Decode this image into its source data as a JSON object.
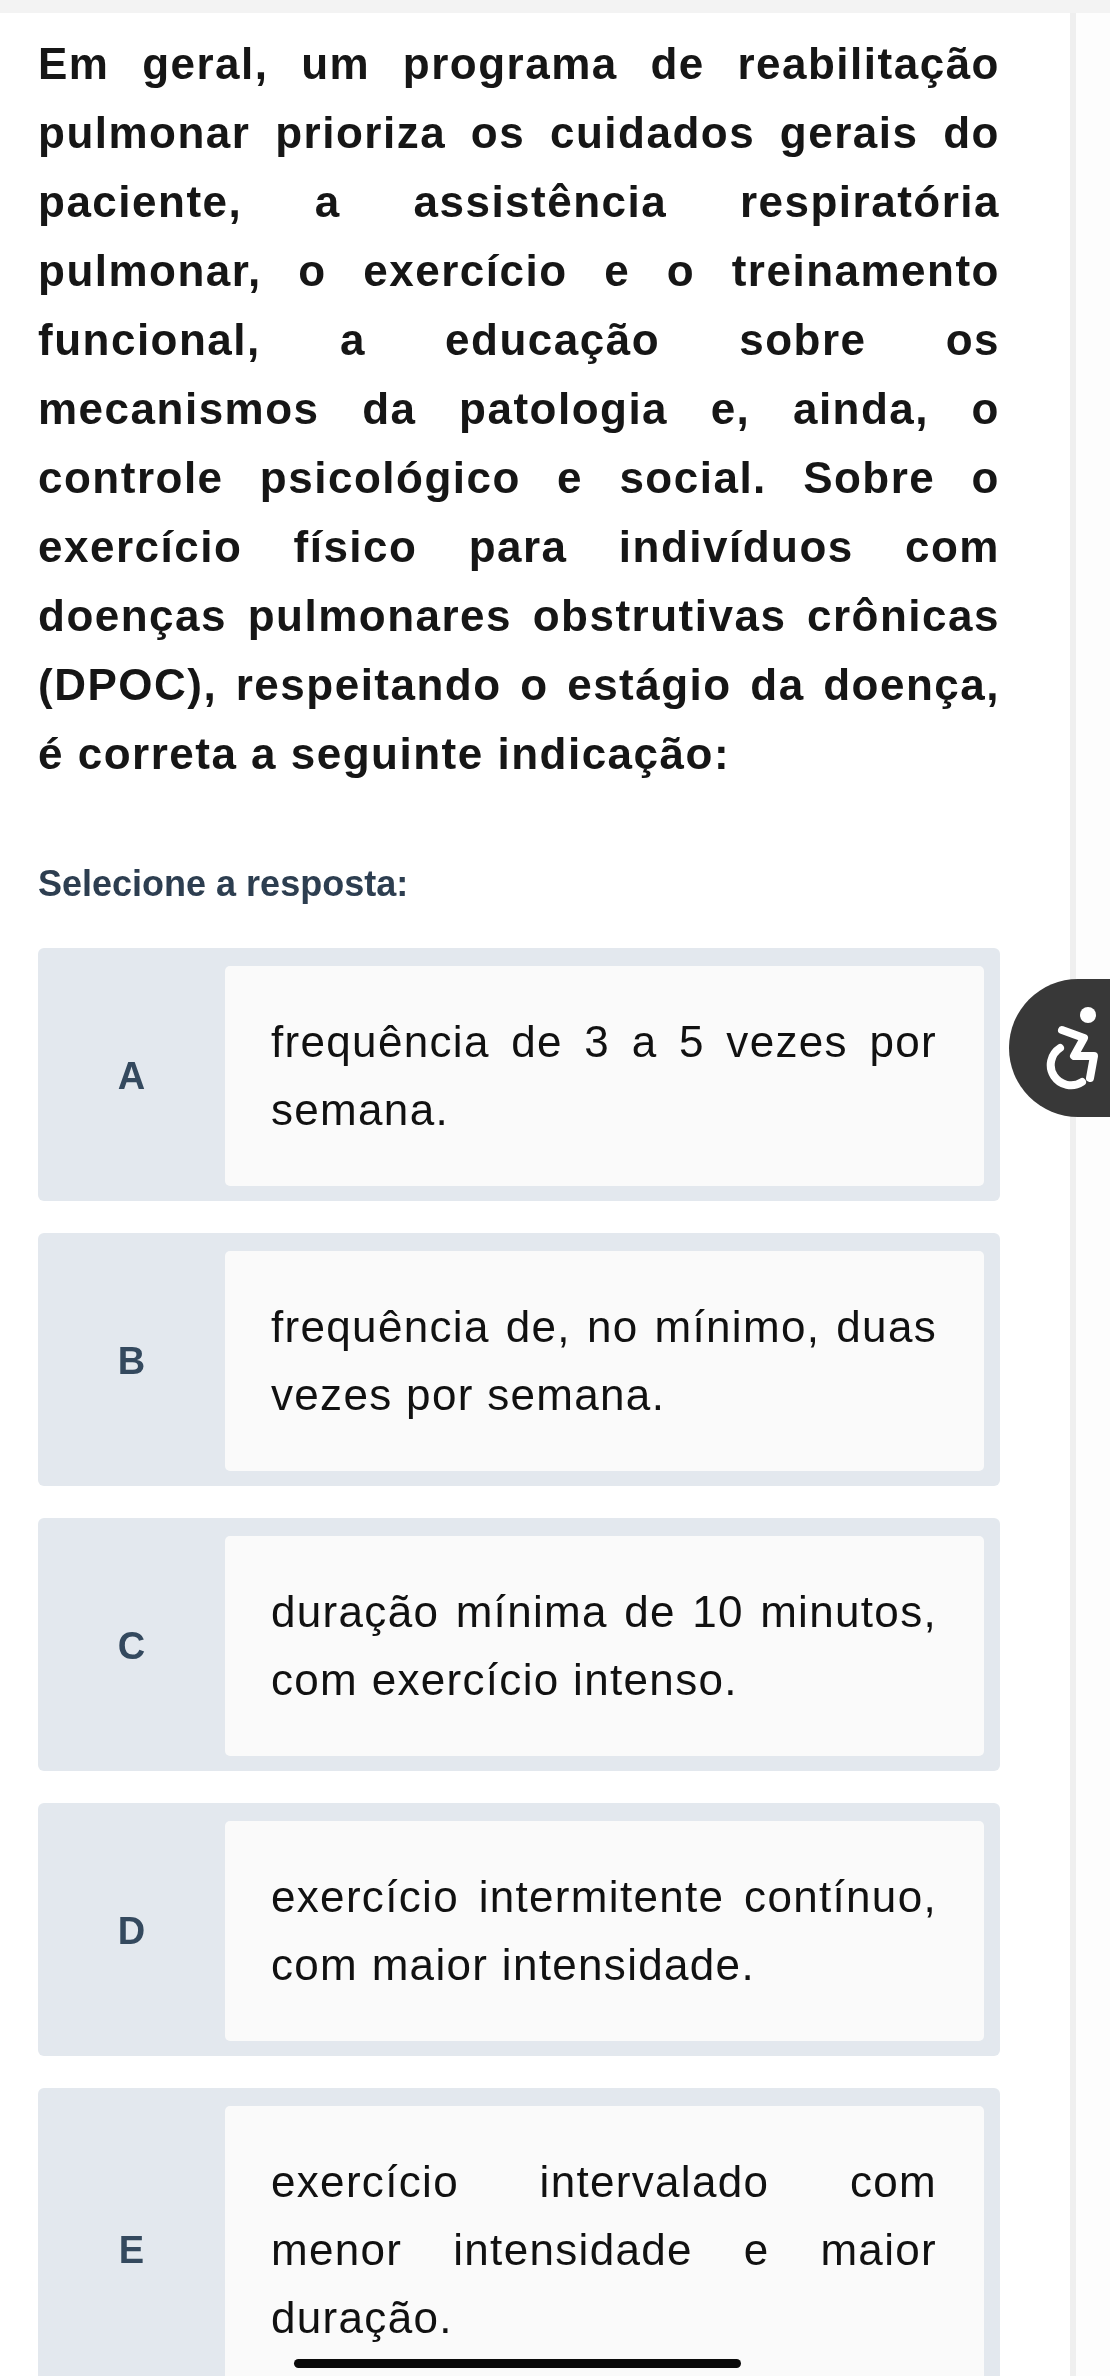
{
  "question": "Em geral, um programa de reabilitação pulmonar prioriza os cuidados gerais do paciente, a assistência respiratória pulmonar, o exercício e o treinamento funcional, a educação sobre os mecanismos da patologia e, ainda, o controle psicológico e social. Sobre o exercício físico para indivíduos com doenças pulmonares obstrutivas crônicas (DPOC), respeitando o estágio da doença, é correta a seguinte indicação:",
  "prompt": "Selecione a resposta:",
  "options": [
    {
      "letter": "A",
      "text": "frequência de 3 a 5 vezes por semana.",
      "selected": false
    },
    {
      "letter": "B",
      "text": "frequência de, no mínimo, duas vezes por semana.",
      "selected": false
    },
    {
      "letter": "C",
      "text": "duração mínima de 10 minutos, com exercício intenso.",
      "selected": false
    },
    {
      "letter": "D",
      "text": "exercício intermitente contínuo, com maior intensidade.",
      "selected": false
    },
    {
      "letter": "E",
      "text": "exercício intervalado com menor intensidade e maior duração.",
      "selected": false
    }
  ]
}
